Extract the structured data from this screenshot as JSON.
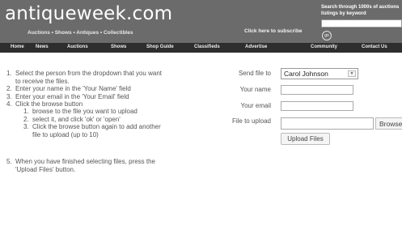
{
  "header": {
    "logo": "antiqueweek.com",
    "tagline": "Auctions • Shows • Antiques • Collectibles",
    "subscribe": "Click here to subscribe",
    "search_text": "Search through 1000s of auctions listings by keyword",
    "search_placeholder": "",
    "go_label": "go"
  },
  "nav": {
    "items": [
      {
        "label": "Home"
      },
      {
        "label": "News"
      },
      {
        "label": "Auctions"
      },
      {
        "label": "Shows"
      },
      {
        "label": "Shop Guide"
      },
      {
        "label": "Classifieds"
      },
      {
        "label": "Advertise"
      },
      {
        "label": "Community"
      },
      {
        "label": "Contact Us"
      }
    ]
  },
  "instructions": {
    "steps": [
      {
        "num": "1.",
        "text": "Select the person from the dropdown that you want to receive the files."
      },
      {
        "num": "2.",
        "text": "Enter your name in the 'Your Name' field"
      },
      {
        "num": "3.",
        "text": "Enter your email in the 'Your Email' field"
      },
      {
        "num": "4.",
        "text": "Click the browse button"
      },
      {
        "num": "5.",
        "text": "When you have finished selecting files, press the 'Upload Files' button."
      }
    ],
    "substeps": [
      {
        "num": "1.",
        "text": "browse to the file you want to upload"
      },
      {
        "num": "2.",
        "text": "select it, and click 'ok' or 'open'"
      },
      {
        "num": "3.",
        "text": "Click the browse button again to add another file to upload (up to 10)"
      }
    ]
  },
  "form": {
    "send_label": "Send file to",
    "send_value": "Carol Johnson",
    "name_label": "Your name",
    "name_value": "",
    "email_label": "Your email",
    "email_value": "",
    "file_label": "File to upload",
    "file_value": "",
    "browse_label": "Browse...",
    "upload_label": "Upload Files"
  }
}
